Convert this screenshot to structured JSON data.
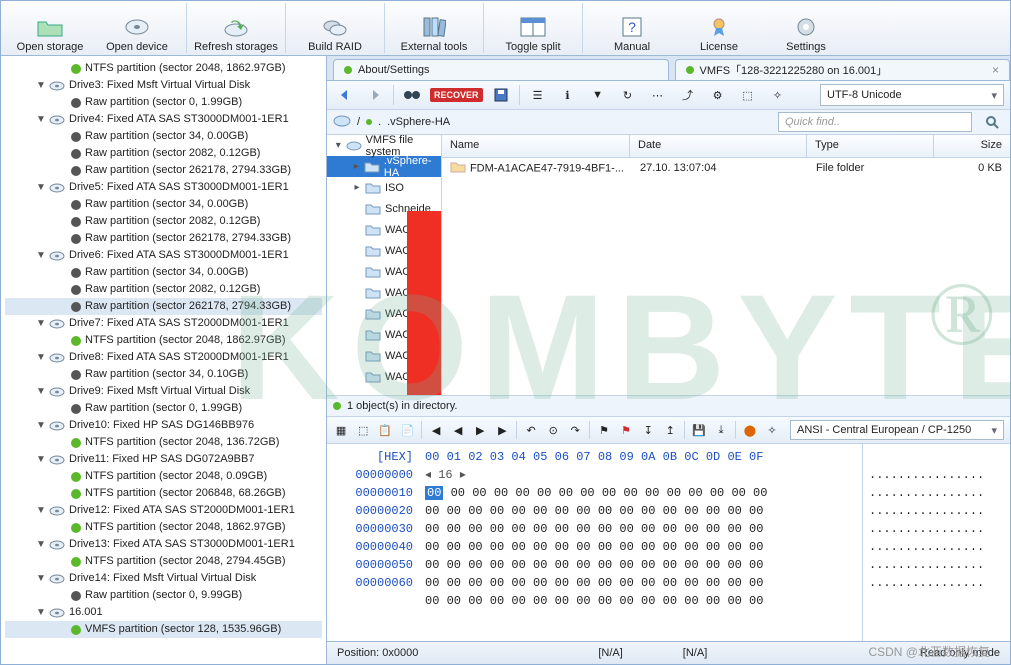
{
  "toolbar": [
    {
      "id": "open-storage",
      "label": "Open storage"
    },
    {
      "id": "open-device",
      "label": "Open device"
    },
    {
      "id": "refresh",
      "label": "Refresh storages"
    },
    {
      "id": "raid",
      "label": "Build RAID"
    },
    {
      "id": "ext",
      "label": "External tools"
    },
    {
      "id": "toggle",
      "label": "Toggle split"
    },
    {
      "id": "manual",
      "label": "Manual"
    },
    {
      "id": "license",
      "label": "License"
    },
    {
      "id": "settings",
      "label": "Settings"
    }
  ],
  "tabs": {
    "a": "About/Settings",
    "b": "VMFS「128-3221225280 on 16.001」"
  },
  "filebar": {
    "recover": "RECOVER",
    "encoding": "UTF-8 Unicode"
  },
  "path": {
    "seg": ".vSphere-HA",
    "quick": "Quick find.."
  },
  "left_tree": [
    {
      "d": 2,
      "t": "part-g",
      "l": "NTFS partition (sector 2048, 1862.97GB)"
    },
    {
      "d": 1,
      "t": "drive",
      "l": "Drive3: Fixed Msft Virtual Virtual Disk",
      "tw": "▼"
    },
    {
      "d": 2,
      "t": "part-k",
      "l": "Raw partition (sector 0, 1.99GB)"
    },
    {
      "d": 1,
      "t": "drive",
      "l": "Drive4: Fixed ATA SAS ST3000DM001-1ER1",
      "tw": "▼"
    },
    {
      "d": 2,
      "t": "part-k",
      "l": "Raw partition (sector 34, 0.00GB)"
    },
    {
      "d": 2,
      "t": "part-k",
      "l": "Raw partition (sector 2082, 0.12GB)"
    },
    {
      "d": 2,
      "t": "part-k",
      "l": "Raw partition (sector 262178, 2794.33GB)"
    },
    {
      "d": 1,
      "t": "drive",
      "l": "Drive5: Fixed ATA SAS ST3000DM001-1ER1",
      "tw": "▼"
    },
    {
      "d": 2,
      "t": "part-k",
      "l": "Raw partition (sector 34, 0.00GB)"
    },
    {
      "d": 2,
      "t": "part-k",
      "l": "Raw partition (sector 2082, 0.12GB)"
    },
    {
      "d": 2,
      "t": "part-k",
      "l": "Raw partition (sector 262178, 2794.33GB)"
    },
    {
      "d": 1,
      "t": "drive",
      "l": "Drive6: Fixed ATA SAS ST3000DM001-1ER1",
      "tw": "▼"
    },
    {
      "d": 2,
      "t": "part-k",
      "l": "Raw partition (sector 34, 0.00GB)"
    },
    {
      "d": 2,
      "t": "part-k",
      "l": "Raw partition (sector 2082, 0.12GB)"
    },
    {
      "d": 2,
      "t": "part-k",
      "l": "Raw partition (sector 262178, 2794.33GB)",
      "sel": true
    },
    {
      "d": 1,
      "t": "drive",
      "l": "Drive7: Fixed ATA SAS ST2000DM001-1ER1",
      "tw": "▼"
    },
    {
      "d": 2,
      "t": "part-g",
      "l": "NTFS partition (sector 2048, 1862.97GB)"
    },
    {
      "d": 1,
      "t": "drive",
      "l": "Drive8: Fixed ATA SAS ST2000DM001-1ER1",
      "tw": "▼"
    },
    {
      "d": 2,
      "t": "part-k",
      "l": "Raw partition (sector 34, 0.10GB)"
    },
    {
      "d": 1,
      "t": "drive",
      "l": "Drive9: Fixed Msft Virtual Virtual Disk",
      "tw": "▼"
    },
    {
      "d": 2,
      "t": "part-k",
      "l": "Raw partition (sector 0, 1.99GB)"
    },
    {
      "d": 1,
      "t": "drive",
      "l": "Drive10: Fixed HP SAS DG146BB976",
      "tw": "▼"
    },
    {
      "d": 2,
      "t": "part-g",
      "l": "NTFS partition (sector 2048, 136.72GB)"
    },
    {
      "d": 1,
      "t": "drive",
      "l": "Drive11: Fixed HP SAS DG072A9BB7",
      "tw": "▼"
    },
    {
      "d": 2,
      "t": "part-g",
      "l": "NTFS partition (sector 2048, 0.09GB)"
    },
    {
      "d": 2,
      "t": "part-g",
      "l": "NTFS partition (sector 206848, 68.26GB)"
    },
    {
      "d": 1,
      "t": "drive",
      "l": "Drive12: Fixed ATA SAS ST2000DM001-1ER1",
      "tw": "▼"
    },
    {
      "d": 2,
      "t": "part-g",
      "l": "NTFS partition (sector 2048, 1862.97GB)"
    },
    {
      "d": 1,
      "t": "drive",
      "l": "Drive13: Fixed ATA SAS ST3000DM001-1ER1",
      "tw": "▼"
    },
    {
      "d": 2,
      "t": "part-g",
      "l": "NTFS partition (sector 2048, 2794.45GB)"
    },
    {
      "d": 1,
      "t": "drive",
      "l": "Drive14: Fixed Msft Virtual Virtual Disk",
      "tw": "▼"
    },
    {
      "d": 2,
      "t": "part-k",
      "l": "Raw partition (sector 0, 9.99GB)"
    },
    {
      "d": 1,
      "t": "vol",
      "l": "16.001",
      "tw": "▼"
    },
    {
      "d": 2,
      "t": "part-g",
      "l": "VMFS partition (sector 128, 1535.96GB)",
      "sel": true
    }
  ],
  "vmfs": {
    "root": "VMFS file system",
    "items": [
      {
        "l": ".vSphere-HA",
        "sel": true,
        "tw": "▸"
      },
      {
        "l": "ISO",
        "tw": "▸"
      },
      {
        "l": "Schneide"
      },
      {
        "l": "WACN00"
      },
      {
        "l": "WACN00               1"
      },
      {
        "l": "WACN00               2"
      },
      {
        "l": "WACN00"
      },
      {
        "l": "WACN00"
      },
      {
        "l": "WACN00"
      },
      {
        "l": "WACN00"
      },
      {
        "l": "WACN00"
      }
    ]
  },
  "elist": {
    "headers": [
      "Name",
      "Date",
      "Type",
      "Size"
    ],
    "row": {
      "name": "FDM-A1ACAE47-7919-4BF1-...",
      "date": "27.10.         13:07:04",
      "type": "File folder",
      "size": "0 KB"
    }
  },
  "dircount": "1 object(s) in directory.",
  "hex": {
    "encoding": "ANSI - Central European / CP-1250",
    "header": "00 01 02 03 04 05 06 07 08 09 0A 0B 0C 0D 0E 0F",
    "nav": "◂  16  ▸",
    "offsets": [
      "00000000",
      "00000010",
      "00000020",
      "00000030",
      "00000040",
      "00000050",
      "00000060"
    ],
    "row": "00 00 00 00 00 00 00 00 00 00 00 00 00 00 00 00",
    "asc": "................"
  },
  "status": {
    "pos": "Position: 0x0000",
    "na": "[N/A]",
    "ro": "Read only mode"
  },
  "watermark": "KOMBYTE",
  "wm_r": "®",
  "credit": "CSDN @北亚数据恢复"
}
